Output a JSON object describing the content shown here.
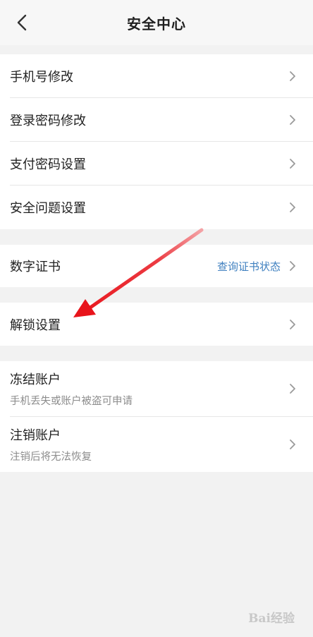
{
  "header": {
    "title": "安全中心",
    "back_icon": "chevron-left-icon"
  },
  "groups": {
    "account": [
      {
        "label": "手机号修改"
      },
      {
        "label": "登录密码修改"
      },
      {
        "label": "支付密码设置"
      },
      {
        "label": "安全问题设置"
      }
    ],
    "certificate": {
      "label": "数字证书",
      "value": "查询证书状态"
    },
    "unlock": {
      "label": "解锁设置"
    },
    "danger": [
      {
        "label": "冻结账户",
        "sublabel": "手机丢失或账户被盗可申请"
      },
      {
        "label": "注销账户",
        "sublabel": "注销后将无法恢复"
      }
    ]
  },
  "annotation": {
    "arrow_color": "#e8141b"
  },
  "watermark": {
    "text": "Bai经验"
  },
  "colors": {
    "background": "#f2f2f2",
    "card": "#ffffff",
    "link": "#3e7fbf",
    "chevron": "#9a9a9a"
  }
}
